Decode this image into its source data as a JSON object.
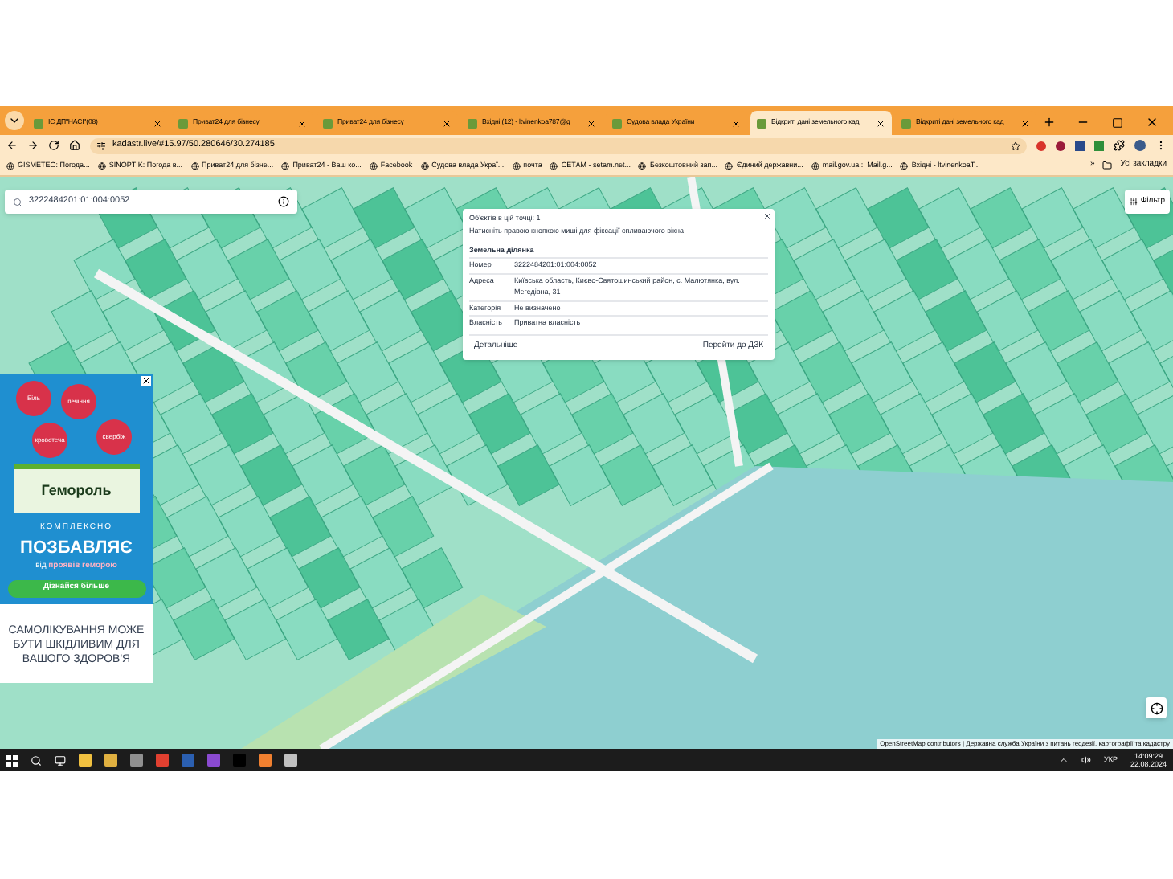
{
  "tabs": [
    {
      "label": "ІС ДП\"НАСІ\"(08)",
      "selected": false
    },
    {
      "label": "Приват24 для бізнесу",
      "selected": false
    },
    {
      "label": "Приват24 для бізнесу",
      "selected": false
    },
    {
      "label": "Вхідні (12) - ltvinenkoa787@g",
      "selected": false
    },
    {
      "label": "Судова влада України",
      "selected": false
    },
    {
      "label": "Відкриті дані земельного кад",
      "selected": true
    },
    {
      "label": "Відкриті дані земельного кад",
      "selected": false
    }
  ],
  "address": "kadastr.live/#15.97/50.280646/30.274185",
  "bookmarks": [
    "GISMETEO: Погода...",
    "SINOPTIK: Погода в...",
    "Приват24 для бізне...",
    "Приват24 - Ваш ко...",
    "Facebook",
    "Судова влада Украї...",
    "почта",
    "СЕТАМ - setam.net...",
    "Безкоштовний зап...",
    "Єдиний державни...",
    "mail.gov.ua :: Mail.g...",
    "Вхідні - ltvinenkoaT..."
  ],
  "bookmarks_more": "»",
  "all_bookmarks": "Усі закладки",
  "search": {
    "value": "3222484201:01:004:0052"
  },
  "filter_button": "Фільтр",
  "popup": {
    "count": "Об'єктів в цій точці: 1",
    "hint": "Натисніть правою кнопкою миші для фіксації спливаючого вікна",
    "heading": "Земельна ділянка",
    "rows": [
      {
        "label": "Номер",
        "value": "3222484201:01:004:0052"
      },
      {
        "label": "Адреса",
        "value": "Київська область, Києво-Святошинський район, с. Малютянка, вул. Мегедівна, 31"
      },
      {
        "label": "Категорія",
        "value": "Не визначено"
      },
      {
        "label": "Власність",
        "value": "Приватна власність"
      }
    ],
    "details_button": "Детальніше",
    "dzk_button": "Перейти до ДЗК"
  },
  "ad": {
    "symptoms": [
      "Біль",
      "печіння",
      "кровотеча",
      "свербіж"
    ],
    "product": "Гемороль",
    "line1": "КОМПЛЕКСНО",
    "line2": "ПОЗБАВЛЯЄ",
    "tagline_prefix": "від",
    "tagline_highlight": "проявів геморою",
    "cta": "Дізнайся більше",
    "warning": "САМОЛІКУВАННЯ МОЖЕ БУТИ ШКІДЛИВИМ ДЛЯ ВАШОГО ЗДОРОВ'Я"
  },
  "attribution": "OpenStreetMap contributors | Державна служба України з питань геодезії, картографії та кадастру",
  "taskbar": {
    "language": "УКР",
    "time": "14:09:29",
    "date": "22.08.2024"
  }
}
